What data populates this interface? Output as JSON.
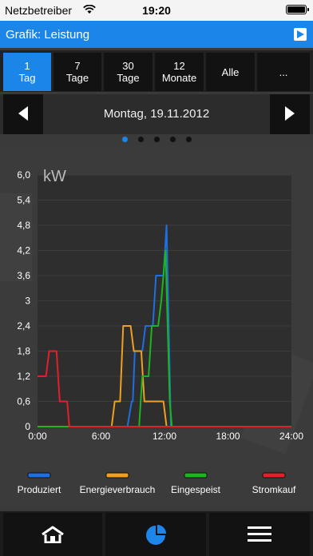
{
  "status_bar": {
    "carrier": "Netzbetreiber",
    "time": "19:20"
  },
  "title_bar": {
    "title": "Grafik: Leistung"
  },
  "range_tabs": [
    {
      "line1": "1",
      "line2": "Tag",
      "active": true
    },
    {
      "line1": "7",
      "line2": "Tage",
      "active": false
    },
    {
      "line1": "30",
      "line2": "Tage",
      "active": false
    },
    {
      "line1": "12",
      "line2": "Monate",
      "active": false
    },
    {
      "line1": "Alle",
      "line2": "",
      "active": false
    },
    {
      "line1": "...",
      "line2": "",
      "active": false
    }
  ],
  "date_nav": {
    "date": "Montag, 19.11.2012"
  },
  "page_dots": {
    "count": 5,
    "active_index": 0
  },
  "colors": {
    "accent": "#1b86e8",
    "produziert": "#1e6fe0",
    "energieverbrauch": "#f0a020",
    "eingespeist": "#1db51d",
    "stromkauf": "#e0202a"
  },
  "chart_data": {
    "type": "line",
    "unit_label": "kW",
    "ylim": [
      0,
      6.0
    ],
    "yticks": [
      "6,0",
      "5,4",
      "4,8",
      "4,2",
      "3,6",
      "3",
      "2,4",
      "1,8",
      "1,2",
      "0,6",
      "0"
    ],
    "xlim": [
      0,
      24
    ],
    "xticks": [
      {
        "value": 0,
        "label": "0:00"
      },
      {
        "value": 6,
        "label": "6:00"
      },
      {
        "value": 12,
        "label": "12:00"
      },
      {
        "value": 18,
        "label": "18:00"
      },
      {
        "value": 24,
        "label": "24:00"
      }
    ],
    "series": [
      {
        "name": "Produziert",
        "color": "#1e6fe0",
        "points": [
          [
            0,
            0
          ],
          [
            8.5,
            0
          ],
          [
            8.9,
            0.6
          ],
          [
            9.0,
            0.6
          ],
          [
            9.2,
            1.8
          ],
          [
            9.9,
            1.8
          ],
          [
            10.2,
            2.4
          ],
          [
            10.9,
            2.4
          ],
          [
            11.2,
            3.6
          ],
          [
            11.9,
            3.6
          ],
          [
            12.2,
            4.8
          ],
          [
            12.6,
            0
          ],
          [
            24,
            0
          ]
        ]
      },
      {
        "name": "Energieverbrauch",
        "color": "#f0a020",
        "points": [
          [
            0,
            0
          ],
          [
            7.0,
            0
          ],
          [
            7.3,
            0.6
          ],
          [
            7.8,
            0.6
          ],
          [
            8.1,
            2.4
          ],
          [
            8.8,
            2.4
          ],
          [
            9.1,
            1.8
          ],
          [
            9.8,
            1.8
          ],
          [
            10.1,
            0.6
          ],
          [
            11.0,
            0.6
          ],
          [
            11.3,
            0.6
          ],
          [
            11.9,
            0.6
          ],
          [
            12.2,
            0
          ],
          [
            24,
            0
          ]
        ]
      },
      {
        "name": "Eingespeist",
        "color": "#1db51d",
        "points": [
          [
            0,
            0
          ],
          [
            9.6,
            0
          ],
          [
            9.9,
            1.2
          ],
          [
            10.5,
            1.2
          ],
          [
            10.8,
            2.4
          ],
          [
            11.4,
            2.4
          ],
          [
            11.7,
            3.0
          ],
          [
            12.1,
            4.2
          ],
          [
            12.5,
            0.6
          ],
          [
            12.7,
            0
          ],
          [
            24,
            0
          ]
        ]
      },
      {
        "name": "Stromkauf",
        "color": "#e0202a",
        "points": [
          [
            0,
            1.2
          ],
          [
            0.8,
            1.2
          ],
          [
            1.1,
            1.8
          ],
          [
            1.8,
            1.8
          ],
          [
            2.1,
            0.6
          ],
          [
            2.8,
            0.6
          ],
          [
            3.0,
            0
          ],
          [
            24,
            0
          ]
        ]
      }
    ],
    "legend": [
      "Produziert",
      "Energieverbrauch",
      "Eingespeist",
      "Stromkauf"
    ]
  },
  "bottom_nav": [
    {
      "icon": "home-icon"
    },
    {
      "icon": "pie-chart-icon",
      "active": true
    },
    {
      "icon": "menu-icon"
    }
  ]
}
